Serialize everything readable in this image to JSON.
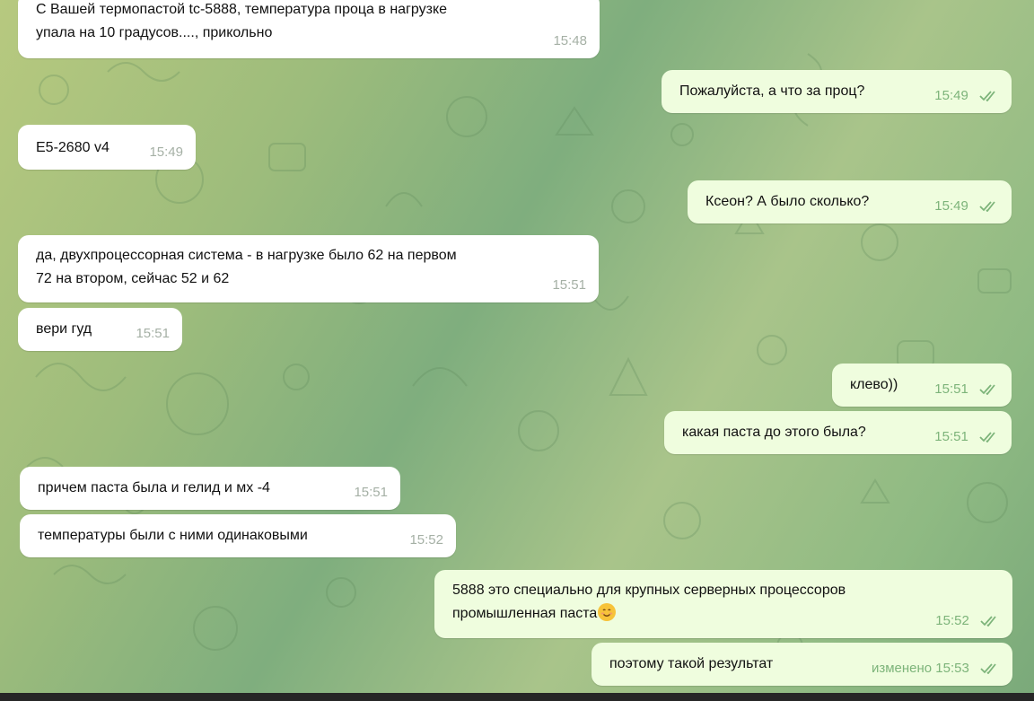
{
  "messages": [
    {
      "dir": "in",
      "lines": [
        "С Вашей термопастой tc-5888, температура проца в нагрузке",
        "упала на 10 градусов...., прикольно"
      ],
      "time": "15:48"
    },
    {
      "dir": "out",
      "text": "Пожалуйста, а что за проц?",
      "time": "15:49"
    },
    {
      "dir": "in",
      "text": "E5-2680 v4",
      "time": "15:49"
    },
    {
      "dir": "out",
      "text": "Ксеон? А было сколько?",
      "time": "15:49"
    },
    {
      "dir": "in",
      "lines": [
        "да, двухпроцессорная система - в нагрузке было 62 на первом",
        "72 на втором, сейчас 52 и 62"
      ],
      "time": "15:51"
    },
    {
      "dir": "in",
      "text": "вери гуд",
      "time": "15:51"
    },
    {
      "dir": "out",
      "text": "клево))",
      "time": "15:51"
    },
    {
      "dir": "out",
      "text": "какая паста до этого была?",
      "time": "15:51"
    },
    {
      "dir": "in",
      "text": "причем паста была и гелид и мх -4",
      "time": "15:51"
    },
    {
      "dir": "in",
      "text": "температуры были с ними одинаковыми",
      "time": "15:52"
    },
    {
      "dir": "out",
      "lines": [
        "5888 это специально для крупных серверных процессоров",
        "промышленная паста"
      ],
      "emoji": "smiling-face-emoji",
      "time": "15:52"
    },
    {
      "dir": "out",
      "text": "поэтому такой результат",
      "edited": "изменено",
      "time": "15:53"
    }
  ],
  "colors": {
    "incoming": "#ffffff",
    "outgoing": "#effdde",
    "out_meta": "#7db47a",
    "in_meta": "#a5b0a5"
  }
}
